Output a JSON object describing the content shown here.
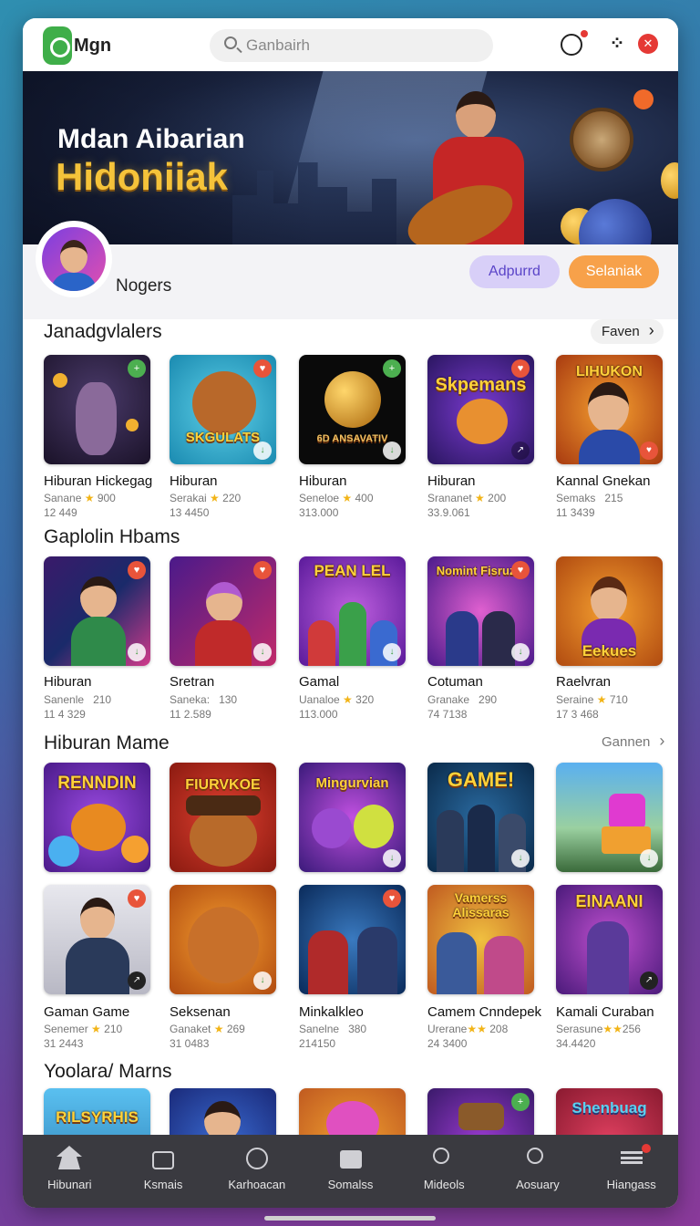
{
  "header": {
    "logo_text": "Mgn",
    "search_placeholder": "Ganbairh"
  },
  "banner": {
    "line1": "Mdan Aibarian",
    "line2": "Hidoniiak"
  },
  "profile": {
    "name": "Nogers",
    "button_primary": "Adpurrd",
    "button_secondary": "Selaniak"
  },
  "sections": [
    {
      "title": "Janadgvlalers",
      "more": "Faven",
      "items": [
        {
          "title": "Hiburan Hickegag",
          "sub1": "Sanane",
          "rating": "900",
          "sub2": "12 449"
        },
        {
          "title": "Hiburan",
          "sub1": "Serakai",
          "rating": "220",
          "sub2": "13 4450"
        },
        {
          "title": "Hiburan",
          "sub1": "Seneloe",
          "rating": "400",
          "sub2": "313.000"
        },
        {
          "title": "Hiburan",
          "sub1": "Srananet",
          "rating": "200",
          "sub2": "33.9.061"
        },
        {
          "title": "Kannal Gnekan",
          "sub1": "Semaks",
          "rating": "215",
          "sub2": "11 3439"
        }
      ],
      "tile_words": [
        "",
        "SKGULATS",
        "6D ANSAVATIV",
        "Skpemans",
        "LIHUKON"
      ]
    },
    {
      "title": "Gaplolin Hbams",
      "more": "",
      "items": [
        {
          "title": "Hiburan",
          "sub1": "Sanenle",
          "rating": "210",
          "sub2": "11 4 329"
        },
        {
          "title": "Sretran",
          "sub1": "Saneka:",
          "rating": "130",
          "sub2": "11 2.589"
        },
        {
          "title": "Gamal",
          "sub1": "Uanaloe",
          "rating": "320",
          "sub2": "113.000"
        },
        {
          "title": "Cotuman",
          "sub1": "Granake",
          "rating": "290",
          "sub2": "74 7138"
        },
        {
          "title": "Raelvran",
          "sub1": "Seraine",
          "rating": "710",
          "sub2": "17 3 468"
        }
      ],
      "tile_words": [
        "",
        "",
        "PEAN LEL",
        "Nomint Fisruzal",
        "Eekues"
      ]
    },
    {
      "title": "Hiburan Mame",
      "more": "Gannen",
      "rows": [
        {
          "items": [],
          "tile_words": [
            "RENNDIN",
            "FIURVKOE",
            "Mingurvian",
            "GAME!",
            ""
          ]
        },
        {
          "items": [
            {
              "title": "Gaman Game",
              "sub1": "Senemer",
              "rating": "210",
              "sub2": "31 2443"
            },
            {
              "title": "Seksenan",
              "sub1": "Ganaket",
              "rating": "269",
              "sub2": "31 0483"
            },
            {
              "title": "Minkalkleo",
              "sub1": "Sanelne",
              "rating": "380",
              "sub2": "214150"
            },
            {
              "title": "Camem Cnndepek",
              "sub1": "Urerane",
              "rating": "208",
              "sub2": "24 3400"
            },
            {
              "title": "Kamali Curaban",
              "sub1": "Serasune",
              "rating": "256",
              "sub2": "34.4420"
            }
          ],
          "tile_words": [
            "",
            "",
            "",
            "Vamerss Alissaras",
            "EINAANI"
          ]
        }
      ]
    },
    {
      "title": "Yoolara/ Marns",
      "tile_words": [
        "RILSYRHIS",
        "",
        "",
        "",
        "Shenbuag"
      ]
    }
  ],
  "nav": [
    {
      "label": "Hibunari",
      "icon": "home-icon"
    },
    {
      "label": "Ksmais",
      "icon": "bag-icon"
    },
    {
      "label": "Karhoacan",
      "icon": "compass-icon"
    },
    {
      "label": "Somalss",
      "icon": "mail-icon"
    },
    {
      "label": "Mideols",
      "icon": "search-icon"
    },
    {
      "label": "Aosuary",
      "icon": "search-icon"
    },
    {
      "label": "Hiangass",
      "icon": "menu-icon"
    }
  ],
  "colors": {
    "accent_green": "#3fae49",
    "button_primary_bg": "#d8cff8",
    "button_secondary_bg": "#f7a14a",
    "nav_bg": "#3a3a40",
    "star": "#f2b417"
  }
}
